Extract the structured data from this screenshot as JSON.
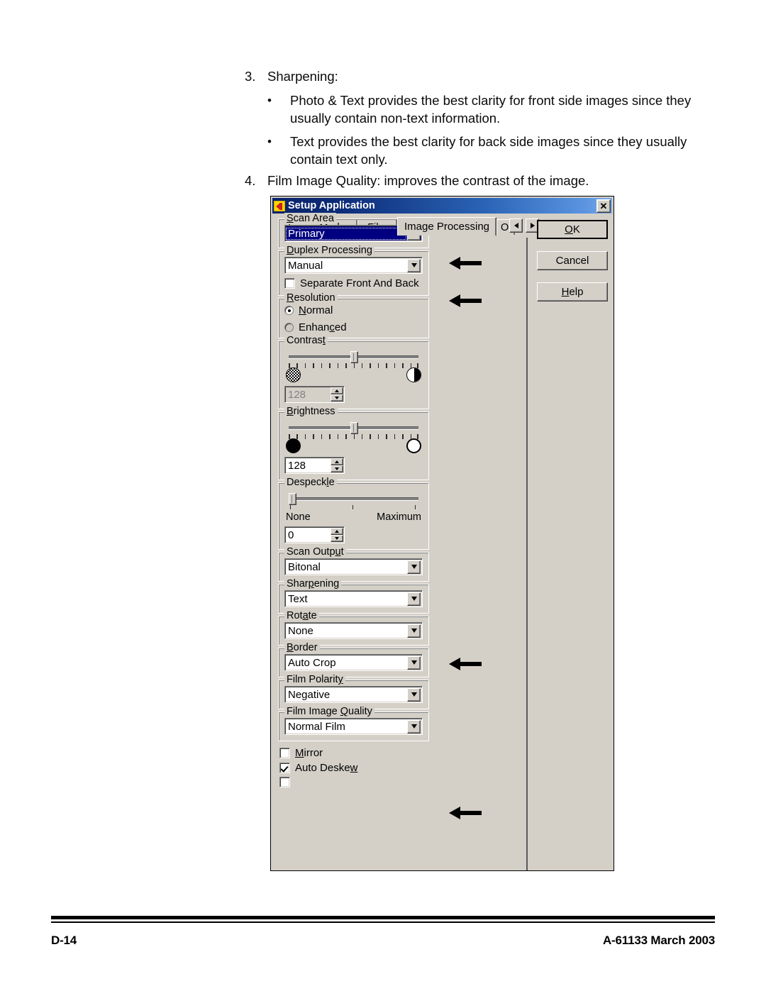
{
  "document": {
    "items": [
      {
        "num": "3.",
        "text": "Sharpening:"
      },
      {
        "bullet": "•",
        "text": "Photo & Text provides the best clarity for front side images since they usually contain non-text information."
      },
      {
        "bullet": "•",
        "text": "Text provides the best clarity for back side images since they usually contain text only."
      },
      {
        "num": "4.",
        "text": "Film Image Quality: improves the contrast of the image."
      }
    ]
  },
  "footer": {
    "left": "D-14",
    "right": "A-61133  March 2003"
  },
  "dialog": {
    "title": "Setup Application",
    "icon": "kodak-k-icon",
    "close_label": "✕",
    "tabs": [
      {
        "label": "Image Marks",
        "active": false
      },
      {
        "label": "Film",
        "active": false
      },
      {
        "label": "Image Processing",
        "active": true
      },
      {
        "label": "Ou",
        "active": false,
        "clipped": true
      }
    ],
    "tab_scroll": {
      "left": "◄",
      "right": "►"
    },
    "buttons": [
      {
        "label": "OK",
        "default": true
      },
      {
        "label": "Cancel",
        "default": false
      },
      {
        "label": "Help",
        "default": false
      }
    ],
    "groups": {
      "scan_area": {
        "label": "Scan Area",
        "value": "Primary",
        "selected": true
      },
      "duplex_processing": {
        "label": "Duplex Processing",
        "value": "Manual",
        "checkbox_label": "Separate Front And Back",
        "checkbox_checked": false
      },
      "resolution": {
        "label": "Resolution",
        "options": [
          {
            "label": "Normal",
            "checked": true
          },
          {
            "label": "Enhanced",
            "checked": false
          }
        ]
      },
      "contrast": {
        "label": "Contrast",
        "value": "128",
        "enabled": false,
        "left_icon": "dither-circle-icon",
        "right_icon": "half-circle-icon",
        "slider_percent": 50,
        "tick_count": 17
      },
      "brightness": {
        "label": "Brightness",
        "value": "128",
        "enabled": true,
        "left_icon": "filled-circle-icon",
        "right_icon": "empty-circle-icon",
        "slider_percent": 50,
        "tick_count": 17
      },
      "despeckle": {
        "label": "Despeckle",
        "value": "0",
        "min_label": "None",
        "max_label": "Maximum",
        "slider_percent": 0,
        "tick_count": 3
      },
      "scan_output": {
        "label": "Scan Output",
        "value": "Bitonal"
      },
      "sharpening": {
        "label": "Sharpening",
        "value": "Text"
      },
      "rotate": {
        "label": "Rotate",
        "value": "None"
      },
      "border": {
        "label": "Border",
        "value": "Auto Crop"
      },
      "film_polarity": {
        "label": "Film Polarity",
        "value": "Negative"
      },
      "film_image_quality": {
        "label": "Film Image Quality",
        "value": "Normal Film"
      }
    },
    "checkboxes": [
      {
        "label": "Mirror",
        "checked": false
      },
      {
        "label": "Auto Deskew",
        "checked": true
      }
    ]
  },
  "annotations": {
    "arrow_count": 4,
    "targets": [
      "Scan Area",
      "Duplex Processing",
      "Sharpening",
      "Film Image Quality"
    ]
  },
  "colors": {
    "dialog_face": "#d4d0c8",
    "title_gradient_start": "#0a246a",
    "title_gradient_end": "#7aa9e8",
    "selection": "#000080",
    "page_background": "#ffffff"
  }
}
